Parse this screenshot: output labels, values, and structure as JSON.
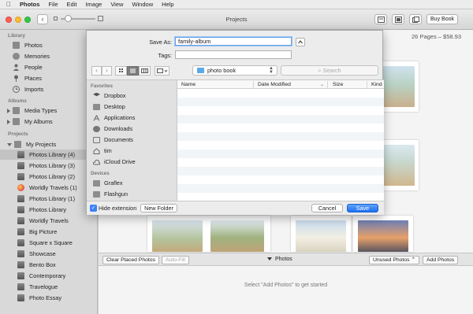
{
  "menubar": {
    "app": "Photos",
    "items": [
      "File",
      "Edit",
      "Image",
      "View",
      "Window",
      "Help"
    ]
  },
  "window": {
    "title": "Projects",
    "buy_label": "Buy Book",
    "back_label": "‹"
  },
  "sidebar": {
    "library_heading": "Library",
    "library_items": [
      "Photos",
      "Memories",
      "People",
      "Places",
      "Imports"
    ],
    "albums_heading": "Albums",
    "album_items": [
      "Media Types",
      "My Albums"
    ],
    "projects_heading": "Projects",
    "projects_folder": "My Projects",
    "project_items": [
      "Photos Library (4)",
      "Photos Library (3)",
      "Photos Library (2)",
      "Worldly Travels (1)",
      "Photos Library (1)",
      "Photos Library",
      "Worldly Travels",
      "Big Picture",
      "Square x Square",
      "Showcase",
      "Bento Box",
      "Contemporary",
      "Travelogue",
      "Photo Essay"
    ],
    "selected_item": "Photos Library (4)"
  },
  "main": {
    "pages_info": "26 Pages – $58.93",
    "clear_label": "Clear Placed Photos",
    "autofill_label": "Auto-Fill",
    "photos_label": "Photos",
    "unused_label": "Unused Photos",
    "add_label": "Add Photos",
    "hint": "Select \"Add Photos\" to get started"
  },
  "dialog": {
    "save_as_label": "Save As:",
    "save_as_value": "family-album",
    "tags_label": "Tags:",
    "tags_value": "",
    "location": "photo book",
    "search_placeholder": "Search",
    "favorites_heading": "Favorites",
    "favorites": [
      "Dropbox",
      "Desktop",
      "Applications",
      "Downloads",
      "Documents",
      "tim",
      "iCloud Drive"
    ],
    "devices_heading": "Devices",
    "devices": [
      "Graflex",
      "Flashgun"
    ],
    "columns": [
      "Name",
      "Date Modified",
      "Size",
      "Kind"
    ],
    "hide_extension": "Hide extension",
    "new_folder": "New Folder",
    "cancel": "Cancel",
    "save": "Save"
  }
}
